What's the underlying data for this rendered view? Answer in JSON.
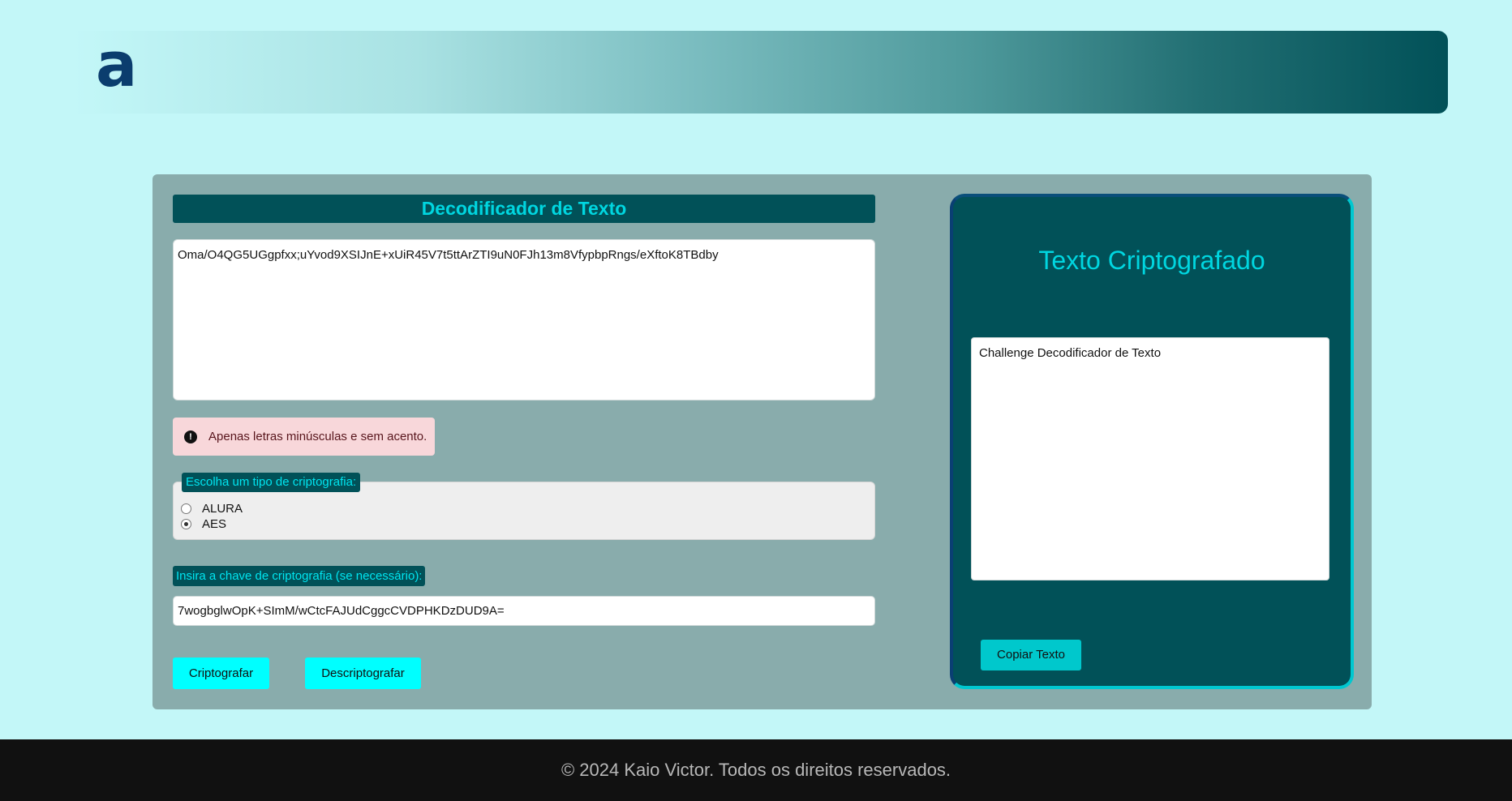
{
  "header": {
    "logo_text": "a"
  },
  "encoder": {
    "title": "Decodificador de Texto",
    "input_value": "Oma/O4QG5UGgpfxx;uYvod9XSIJnE+xUiR45V7t5ttArZTI9uN0FJh13m8VfypbpRngs/eXftoK8TBdby",
    "alert_icon": "exclamation-icon",
    "alert_text": "Apenas letras minúsculas e sem acento.",
    "crypto_legend": "Escolha um tipo de criptografia:",
    "options": [
      {
        "label": "ALURA",
        "checked": false
      },
      {
        "label": "AES",
        "checked": true
      }
    ],
    "key_label": "Insira a chave de criptografia (se necessário):",
    "key_value": "7wogbglwOpK+SImM/wCtcFAJUdCggcCVDPHKDzDUD9A=",
    "encrypt_button": "Criptografar",
    "decrypt_button": "Descriptografar"
  },
  "result": {
    "title": "Texto Criptografado",
    "output_value": "Challenge Decodificador de Texto",
    "copy_button": "Copiar Texto"
  },
  "footer": {
    "text": "© 2024 Kaio Victor. Todos os direitos reservados."
  },
  "colors": {
    "background": "#c3f7f8",
    "panel": "#015158",
    "accent": "#00ffff",
    "alert_bg": "#f8d7da"
  }
}
